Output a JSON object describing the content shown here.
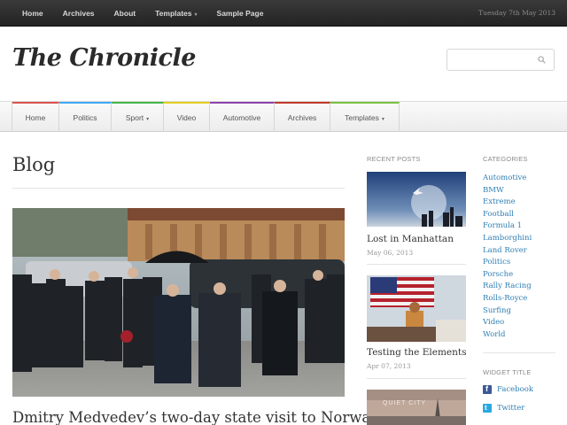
{
  "topbar": {
    "nav": [
      {
        "label": "Home"
      },
      {
        "label": "Archives"
      },
      {
        "label": "About"
      },
      {
        "label": "Templates",
        "caret": "▾"
      },
      {
        "label": "Sample Page"
      }
    ],
    "date": "Tuesday 7th May 2013"
  },
  "header": {
    "logo": "The Chronicle",
    "search_placeholder": ""
  },
  "mainnav": {
    "items": [
      {
        "label": "Home",
        "color": "#d9534f"
      },
      {
        "label": "Politics",
        "color": "#3fa9f5"
      },
      {
        "label": "Sport",
        "caret": "▾",
        "color": "#44b549"
      },
      {
        "label": "Video",
        "color": "#e3d020"
      },
      {
        "label": "Automotive",
        "color": "#8e44ad"
      },
      {
        "label": "Archives",
        "color": "#c0392b"
      },
      {
        "label": "Templates",
        "caret": "▾",
        "color": "#7ac142"
      }
    ]
  },
  "blog": {
    "title": "Blog",
    "post_title": "Dmitry Medvedev’s two-day state visit to Norway"
  },
  "recent": {
    "heading": "Recent Posts",
    "posts": [
      {
        "title": "Lost in Manhattan",
        "date": "May 06, 2013"
      },
      {
        "title": "Testing the Elements",
        "date": "Apr 07, 2013"
      },
      {
        "title": "",
        "date": "",
        "image_text": "QUIET CITY"
      }
    ]
  },
  "categories": {
    "heading": "Categories",
    "items": [
      "Automotive",
      "BMW",
      "Extreme",
      "Football",
      "Formula 1",
      "Lamborghini",
      "Land Rover",
      "Politics",
      "Porsche",
      "Rally Racing",
      "Rolls-Royce",
      "Surfing",
      "Video",
      "World"
    ]
  },
  "widget": {
    "heading": "Widget Title",
    "links": [
      {
        "label": "Facebook",
        "icon": "facebook-icon",
        "color": "#3b5998"
      },
      {
        "label": "Twitter",
        "icon": "twitter-icon",
        "color": "#2aa9e0"
      }
    ]
  }
}
